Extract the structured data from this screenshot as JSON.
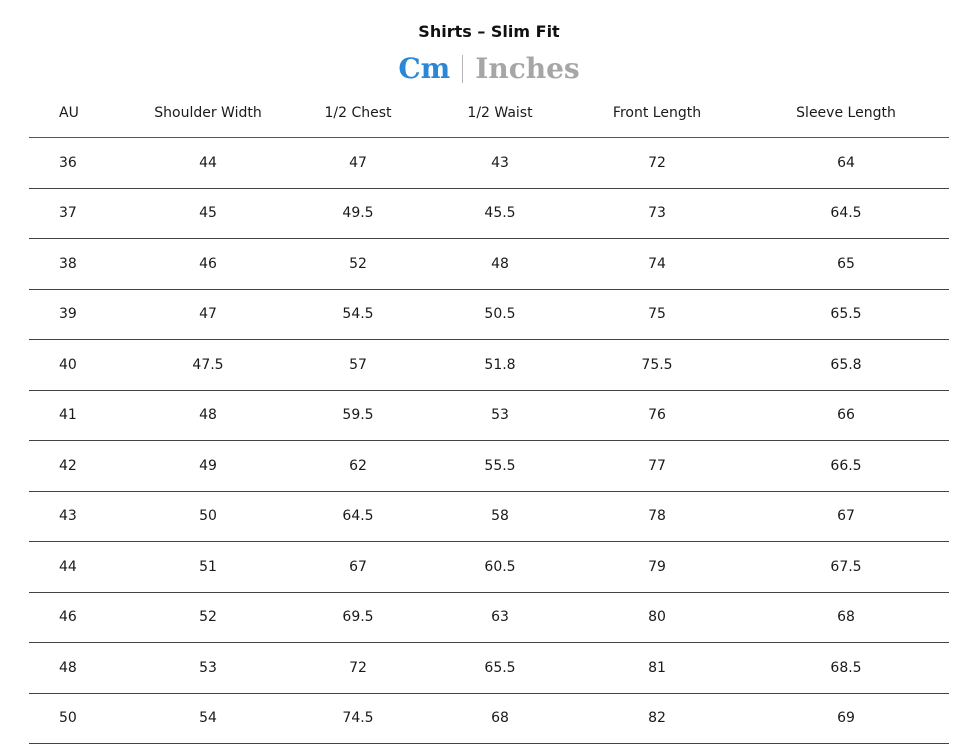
{
  "title": "Shirts – Slim Fit",
  "units": {
    "cm_label": "Cm",
    "inches_label": "Inches",
    "active": "Cm"
  },
  "colors": {
    "active_unit": "#2a86d6",
    "inactive_unit": "#a6a6a6"
  },
  "table": {
    "headers": [
      "AU",
      "Shoulder Width",
      "1/2 Chest",
      "1/2 Waist",
      "Front Length",
      "Sleeve Length"
    ],
    "rows": [
      [
        "36",
        "44",
        "47",
        "43",
        "72",
        "64"
      ],
      [
        "37",
        "45",
        "49.5",
        "45.5",
        "73",
        "64.5"
      ],
      [
        "38",
        "46",
        "52",
        "48",
        "74",
        "65"
      ],
      [
        "39",
        "47",
        "54.5",
        "50.5",
        "75",
        "65.5"
      ],
      [
        "40",
        "47.5",
        "57",
        "51.8",
        "75.5",
        "65.8"
      ],
      [
        "41",
        "48",
        "59.5",
        "53",
        "76",
        "66"
      ],
      [
        "42",
        "49",
        "62",
        "55.5",
        "77",
        "66.5"
      ],
      [
        "43",
        "50",
        "64.5",
        "58",
        "78",
        "67"
      ],
      [
        "44",
        "51",
        "67",
        "60.5",
        "79",
        "67.5"
      ],
      [
        "46",
        "52",
        "69.5",
        "63",
        "80",
        "68"
      ],
      [
        "48",
        "53",
        "72",
        "65.5",
        "81",
        "68.5"
      ],
      [
        "50",
        "54",
        "74.5",
        "68",
        "82",
        "69"
      ]
    ]
  }
}
